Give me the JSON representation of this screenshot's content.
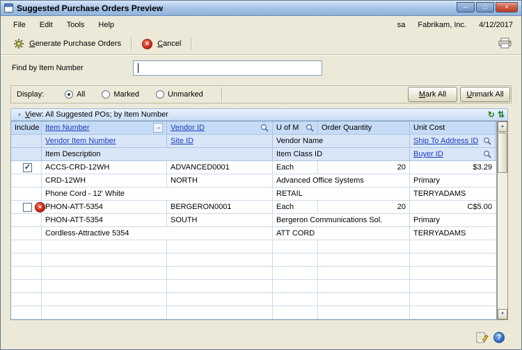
{
  "window": {
    "title": "Suggested Purchase Orders Preview"
  },
  "titlebar": {
    "minimize_glyph": "─",
    "maximize_glyph": "□",
    "close_glyph": "×"
  },
  "menu": {
    "items": [
      "File",
      "Edit",
      "Tools",
      "Help"
    ],
    "user": "sa",
    "company": "Fabrikam, Inc.",
    "date": "4/12/2017"
  },
  "toolbar": {
    "generate_label": "Generate Purchase Orders",
    "cancel_label": "Cancel",
    "cancel_icon_glyph": "×"
  },
  "find": {
    "label": "Find by Item Number",
    "value": ""
  },
  "display": {
    "label": "Display:",
    "options": [
      {
        "label": "All",
        "selected": true
      },
      {
        "label": "Marked",
        "selected": false
      },
      {
        "label": "Unmarked",
        "selected": false
      }
    ],
    "mark_all_label": "Mark All",
    "unmark_all_label": "Unmark All"
  },
  "view_bar": {
    "label": "View: All Suggested POs; by Item Number",
    "dropdown_glyph": "▾",
    "refresh_glyph": "↻",
    "updown_glyph": "⇅"
  },
  "table": {
    "headers": {
      "include": "Include",
      "item_number": "Item Number",
      "vendor_id": "Vendor ID",
      "uofm": "U of M",
      "order_quantity": "Order Quantity",
      "unit_cost": "Unit Cost",
      "vendor_item_number": "Vendor Item Number",
      "site_id": "Site ID",
      "vendor_name": "Vendor Name",
      "ship_to_address_id": "Ship To Address ID",
      "item_description": "Item Description",
      "item_class_id": "Item Class ID",
      "buyer_id": "Buyer ID"
    },
    "records": [
      {
        "included": true,
        "error": false,
        "item_number": "ACCS-CRD-12WH",
        "vendor_id": "ADVANCED0001",
        "uofm": "Each",
        "order_quantity": "20",
        "unit_cost": "$3.29",
        "vendor_item_number": "CRD-12WH",
        "site_id": "NORTH",
        "vendor_name": "Advanced Office Systems",
        "ship_to_address_id": "Primary",
        "item_description": "Phone Cord - 12' White",
        "item_class_id": "RETAIL",
        "buyer_id": "TERRYADAMS"
      },
      {
        "included": false,
        "error": true,
        "item_number": "PHON-ATT-5354",
        "vendor_id": "BERGERON0001",
        "uofm": "Each",
        "order_quantity": "20",
        "unit_cost": "C$5.00",
        "vendor_item_number": "PHON-ATT-5354",
        "site_id": "SOUTH",
        "vendor_name": "Bergeron Communications Sol.",
        "ship_to_address_id": "Primary",
        "item_description": "Cordless-Attractive 5354",
        "item_class_id": "ATT CORD",
        "buyer_id": "TERRYADAMS"
      }
    ]
  },
  "scrollbar": {
    "up_glyph": "▲",
    "down_glyph": "▼"
  },
  "status": {
    "help_glyph": "?"
  },
  "icons": {
    "check_glyph": "✓",
    "error_glyph": "×",
    "sort_glyph": "→"
  }
}
